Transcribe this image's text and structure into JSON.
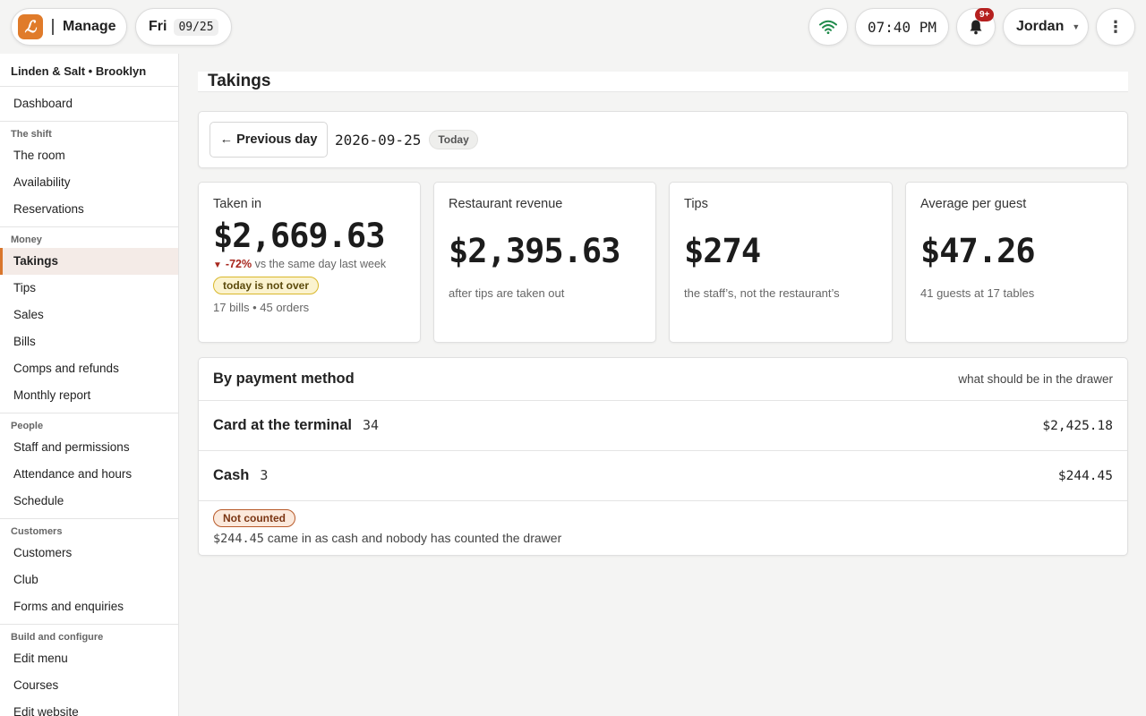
{
  "topbar": {
    "logo_glyph": "ℒ",
    "brand_label": "Manage",
    "day": "Fri",
    "date": "09/25",
    "time": "07:40 PM",
    "notifications_badge": "9+",
    "user": "Jordan",
    "wifi_icon": "wifi-icon",
    "accent_color": "#e07b2a"
  },
  "sidebar": {
    "venue": "Linden & Salt • Brooklyn",
    "dashboard": "Dashboard",
    "groups": [
      {
        "title": "The shift",
        "items": [
          "The room",
          "Availability",
          "Reservations"
        ]
      },
      {
        "title": "Money",
        "items": [
          "Takings",
          "Tips",
          "Sales",
          "Bills",
          "Comps and refunds",
          "Monthly report"
        ]
      },
      {
        "title": "People",
        "items": [
          "Staff and permissions",
          "Attendance and hours",
          "Schedule"
        ]
      },
      {
        "title": "Customers",
        "items": [
          "Customers",
          "Club",
          "Forms and enquiries"
        ]
      },
      {
        "title": "Build and configure",
        "items": [
          "Edit menu",
          "Courses",
          "Edit website"
        ]
      }
    ],
    "active_item": "Takings"
  },
  "page": {
    "title": "Takings",
    "prev_day_label": "← Previous day",
    "current_date": "2026-09-25",
    "today_chip": "Today"
  },
  "stats": {
    "taken_in": {
      "label": "Taken in",
      "value": "$2,669.63",
      "delta_arrow": "▼",
      "delta_pct": "-72%",
      "delta_text": "vs the same day last week",
      "warning": "today is not over",
      "counts": "17 bills • 45 orders"
    },
    "restaurant_revenue": {
      "label": "Restaurant revenue",
      "value": "$2,395.63",
      "sub": "after tips are taken out"
    },
    "tips": {
      "label": "Tips",
      "value": "$274",
      "sub": "the staff’s, not the restaurant’s"
    },
    "avg_guest": {
      "label": "Average per guest",
      "value": "$47.26",
      "sub": "41 guests at 17 tables"
    }
  },
  "payments": {
    "title": "By payment method",
    "hint": "what should be in the drawer",
    "rows": [
      {
        "name": "Card at the terminal",
        "count": "34",
        "amount": "$2,425.18"
      },
      {
        "name": "Cash",
        "count": "3",
        "amount": "$244.45"
      }
    ],
    "status_chip": "Not counted",
    "note_amount": "$244.45",
    "note_text": " came in as cash and nobody has counted the drawer"
  }
}
